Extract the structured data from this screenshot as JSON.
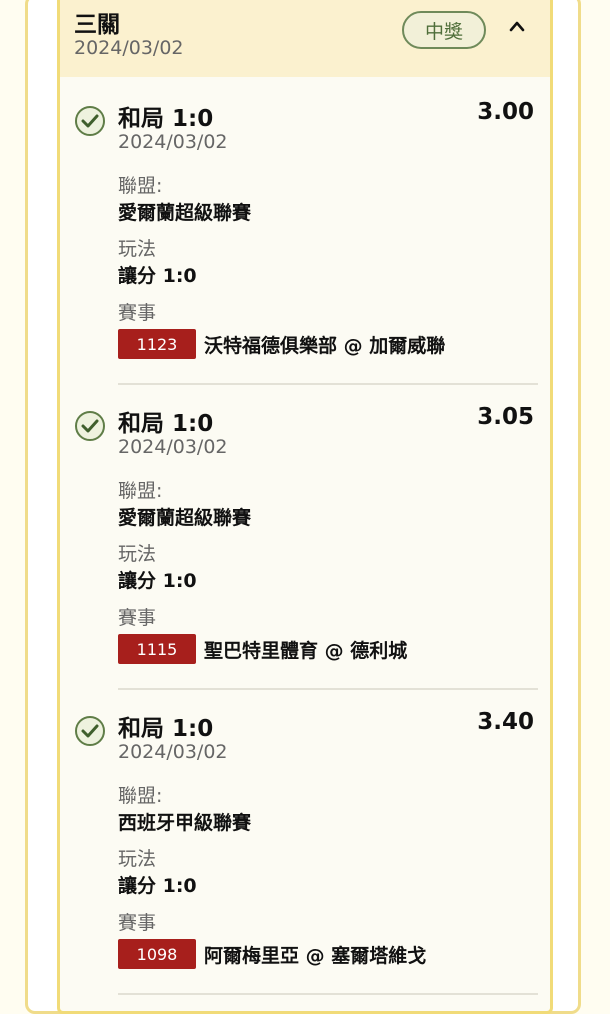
{
  "parlay": {
    "title": "三關",
    "date": "2024/03/02",
    "badge": "中獎"
  },
  "legs": [
    {
      "pick": "和局 1:0",
      "odds": "3.00",
      "date": "2024/03/02",
      "league_label": "聯盟:",
      "league": "愛爾蘭超級聯賽",
      "bet_type_label": "玩法",
      "bet_type": "讓分 1:0",
      "match_label": "賽事",
      "match_id": "1123",
      "match": "沃特福德俱樂部 @ 加爾威聯"
    },
    {
      "pick": "和局 1:0",
      "odds": "3.05",
      "date": "2024/03/02",
      "league_label": "聯盟:",
      "league": "愛爾蘭超級聯賽",
      "bet_type_label": "玩法",
      "bet_type": "讓分 1:0",
      "match_label": "賽事",
      "match_id": "1115",
      "match": "聖巴特里體育 @ 德利城"
    },
    {
      "pick": "和局 1:0",
      "odds": "3.40",
      "date": "2024/03/02",
      "league_label": "聯盟:",
      "league": "西班牙甲級聯賽",
      "bet_type_label": "玩法",
      "bet_type": "讓分 1:0",
      "match_label": "賽事",
      "match_id": "1098",
      "match": "阿爾梅里亞 @ 塞爾塔維戈"
    }
  ],
  "colors": {
    "accent_border": "#f1db78",
    "header_bg": "#fbf1cf",
    "win_green": "#4f6e3a",
    "match_id_red": "#a71f1c"
  }
}
